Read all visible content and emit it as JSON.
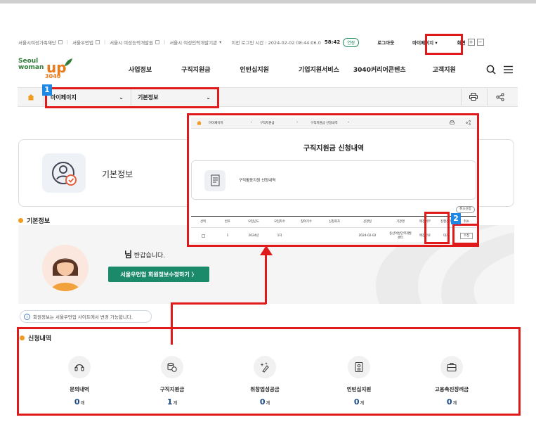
{
  "utility": {
    "links": [
      "서울시여성가족재단",
      "서울우먼업",
      "서울시 여성능력개발원",
      "서울시 여성인력개발기관"
    ],
    "last_login": "이전 로그인 시간 : 2024-02-02 08:44:06.0",
    "timer": "58:42",
    "extend": "연장",
    "logout": "로그아웃",
    "mypage": "마이페이지",
    "zoom_label": "화면",
    "zoom_in": "+",
    "zoom_out": "−"
  },
  "logo": {
    "line1": "Seoul",
    "line2": "woman",
    "up": "up",
    "year": "3040"
  },
  "nav": [
    "사업정보",
    "구직지원금",
    "인턴십지원",
    "기업지원서비스",
    "3040커리어콘텐츠",
    "고객지원"
  ],
  "breadcrumb": {
    "level1": "마이페이지",
    "level2": "기본정보"
  },
  "badges": {
    "one": "1",
    "two": "2"
  },
  "profile": {
    "label": "기본정보"
  },
  "basic_section": {
    "title": "기본정보"
  },
  "greeting": {
    "name_suffix": "님",
    "text": "반갑습니다.",
    "edit_button": "서울우먼업 회원정보수정하기  〉"
  },
  "notice": "회원정보는 서울우먼업 사이트에서 변경 가능합니다.",
  "apply_section": {
    "title": "신청내역",
    "items": [
      {
        "name": "문의내역",
        "count": "0",
        "unit": "개"
      },
      {
        "name": "구직지원금",
        "count": "1",
        "unit": "개"
      },
      {
        "name": "취창업성공금",
        "count": "0",
        "unit": "개"
      },
      {
        "name": "인턴십지원",
        "count": "0",
        "unit": "개"
      },
      {
        "name": "고용촉진장려금",
        "count": "0",
        "unit": "개"
      }
    ]
  },
  "popup": {
    "crumb": [
      "마이페이지",
      "구직지원금",
      "구직지원금 신청내역"
    ],
    "title": "구직지원금 신청내역",
    "card_label": "구직활동지원 신청내역",
    "cancel_all": "취소신청",
    "headers": [
      "선택",
      "번호",
      "모집년도",
      "모집차수",
      "참여기수",
      "신청회차",
      "신청일",
      "기관명",
      "매칭여부",
      "진행상태",
      "취소"
    ],
    "row": [
      "",
      "1",
      "2024년",
      "1차",
      "",
      "",
      "2024-02-02",
      "동산여성인력개발센터",
      "매칭완료",
      "대기",
      "수정"
    ]
  },
  "colors": {
    "accent_red": "#e01a1a",
    "green": "#1b8a6b",
    "orange": "#f29b21",
    "badge_blue": "#1e88e5"
  }
}
